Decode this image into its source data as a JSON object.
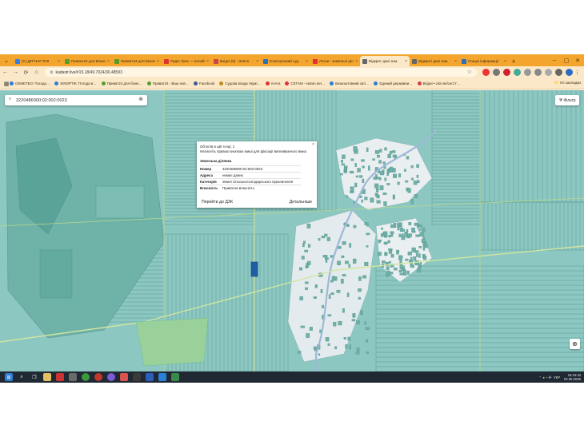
{
  "browser": {
    "tabs": [
      {
        "label": "(C) ДП\"НАС\"Ю9",
        "color": "#3b7ddd"
      },
      {
        "label": "Приват24 для Бізнесу",
        "color": "#5a9c2a"
      },
      {
        "label": "Приват24 для Бізнесу",
        "color": "#5a9c2a"
      },
      {
        "label": "Радіо Трек — онлайн",
        "color": "#d33"
      },
      {
        "label": "Вхідні (5) - ttorino",
        "color": "#c44"
      },
      {
        "label": "Електронний суд",
        "color": "#2c6fb8"
      },
      {
        "label": "Лотки - земельні ділянки",
        "color": "#d33"
      },
      {
        "label": "Відкрит дані зем.",
        "color": "#666",
        "active": true
      },
      {
        "label": "Відкриті дані зем.",
        "color": "#666"
      },
      {
        "label": "Пошук інформації",
        "color": "#2f6db5"
      }
    ],
    "url": "kadastr.live/#15.18/49.7924/30.48593",
    "bookmarks": [
      {
        "label": "OSMETEO: Погода…",
        "color": "#2f7bd6"
      },
      {
        "label": "SINOPTIK: Погода в…",
        "color": "#2f7bd6"
      },
      {
        "label": "Приват24 для бізне…",
        "color": "#5a9c2a"
      },
      {
        "label": "Приват24 - Ваш нов…",
        "color": "#5a9c2a"
      },
      {
        "label": "Facebook",
        "color": "#3b5998"
      },
      {
        "label": "Судова влада Украї…",
        "color": "#c08a1e"
      },
      {
        "label": "почта",
        "color": "#d33"
      },
      {
        "label": "СЕТАМ - setam.net…",
        "color": "#d33"
      },
      {
        "label": "Безкоштовний заті…",
        "color": "#2f7bd6"
      },
      {
        "label": "Єдиний державни…",
        "color": "#2f7bd6"
      },
      {
        "label": "Вхідні • Ukr.net/cer17…",
        "color": "#c44"
      }
    ],
    "all_bookmarks": "Усі закладки"
  },
  "map": {
    "search_value": "3220486900:02:002:0023",
    "filter_label": "Фільтр",
    "popup": {
      "line1": "Об'єктів в цій точці: 1",
      "line2": "Натисніть правою кнопкою миші для фіксації випливаючого вікна",
      "section": "Земельна ділянка",
      "rows": [
        {
          "k": "Номер",
          "v": "3220486900:02:002:0023"
        },
        {
          "k": "Адреса",
          "v": "немає даних"
        },
        {
          "k": "Категорія",
          "v": "Землі сільськогосподарського призначення"
        },
        {
          "k": "Власність",
          "v": "Приватна власність"
        }
      ],
      "go_label": "Перейти до ДЗК",
      "details_label": "Детальніше"
    }
  },
  "taskbar": {
    "lang": "УКР",
    "time": "15:15:43",
    "date": "02.05.2025"
  },
  "colors": {
    "tab_strip": "#f4a52e",
    "toolbar": "#fbe8c8",
    "map_base": "#8cc7c1",
    "parcel_line": "#5f9a93",
    "taskbar": "#1f2833"
  }
}
